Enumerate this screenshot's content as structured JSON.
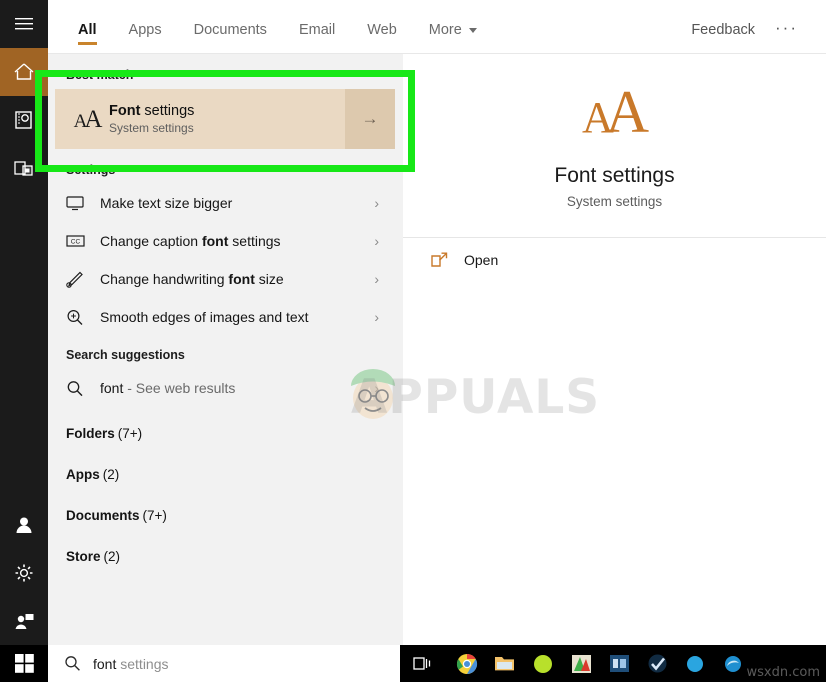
{
  "rail": {
    "items": [
      {
        "name": "hamburger",
        "icon": "hamburger-icon",
        "active": false
      },
      {
        "name": "home",
        "icon": "home-icon",
        "active": true
      },
      {
        "name": "documents",
        "icon": "documents-icon",
        "active": false
      },
      {
        "name": "apps",
        "icon": "apps-icon",
        "active": false
      }
    ],
    "bottom_items": [
      {
        "name": "account",
        "icon": "account-avatar-icon"
      },
      {
        "name": "settings",
        "icon": "gear-icon"
      },
      {
        "name": "feedback",
        "icon": "feedback-person-icon"
      }
    ]
  },
  "tabs": [
    {
      "label": "All",
      "active": true
    },
    {
      "label": "Apps",
      "active": false
    },
    {
      "label": "Documents",
      "active": false
    },
    {
      "label": "Email",
      "active": false
    },
    {
      "label": "Web",
      "active": false
    },
    {
      "label": "More",
      "active": false,
      "has_caret": true
    }
  ],
  "tabbar": {
    "feedback_label": "Feedback",
    "ellipsis_label": "···",
    "accent_color": "#c9842c"
  },
  "results": {
    "best_match_heading": "Best match",
    "best_match": {
      "title_bold": "Font",
      "title_rest": " settings",
      "subtitle": "System settings",
      "icon": "font-AA-icon",
      "arrow": "→",
      "background_color": "#ead9c3",
      "arrow_background_color": "#ddc9ae"
    },
    "settings_heading": "Settings",
    "settings_items": [
      {
        "label_pre": "Make text size bigger",
        "label_bold": "",
        "label_post": "",
        "icon": "monitor-icon",
        "chevron": "›"
      },
      {
        "label_pre": "Change caption ",
        "label_bold": "font",
        "label_post": " settings",
        "icon": "closed-caption-icon",
        "chevron": "›"
      },
      {
        "label_pre": "Change handwriting ",
        "label_bold": "font",
        "label_post": " size",
        "icon": "pen-icon",
        "chevron": "›"
      },
      {
        "label_pre": "Smooth edges of images and text",
        "label_bold": "",
        "label_post": "",
        "icon": "magnifier-plus-icon",
        "chevron": "›"
      }
    ],
    "suggestions_heading": "Search suggestions",
    "suggestion": {
      "query": "font",
      "suffix": " - See web results",
      "icon": "search-icon",
      "chevron": "›"
    },
    "categories": [
      {
        "label": "Folders",
        "count": "(7+)"
      },
      {
        "label": "Apps",
        "count": "(2)"
      },
      {
        "label": "Documents",
        "count": "(7+)"
      },
      {
        "label": "Store",
        "count": "(2)"
      }
    ]
  },
  "preview": {
    "logo_first": "A",
    "logo_second": "A",
    "title": "Font settings",
    "subtitle": "System settings",
    "open_label": "Open",
    "open_icon": "external-link-icon",
    "accent_color": "#c9792a"
  },
  "watermark": {
    "text": "APPUALS",
    "taskbar_text": "wsxdn.com"
  },
  "annotation": {
    "color": "#17e817"
  },
  "taskbar": {
    "start_icon": "windows-logo-icon",
    "search_icon": "search-icon",
    "search_query": "font",
    "search_suffix": " settings",
    "taskview_icon": "task-view-icon",
    "apps": [
      {
        "name": "chrome",
        "icon": "chrome-icon"
      },
      {
        "name": "file-explorer",
        "icon": "folder-icon"
      },
      {
        "name": "green-app",
        "icon": "green-circle-icon"
      },
      {
        "name": "office-app",
        "icon": "office-icon"
      },
      {
        "name": "blue-app",
        "icon": "blue-tile-icon"
      },
      {
        "name": "check-app",
        "icon": "checkmark-icon"
      },
      {
        "name": "light-blue-app",
        "icon": "blue-glow-icon"
      },
      {
        "name": "edge-app",
        "icon": "edge-icon"
      }
    ]
  }
}
